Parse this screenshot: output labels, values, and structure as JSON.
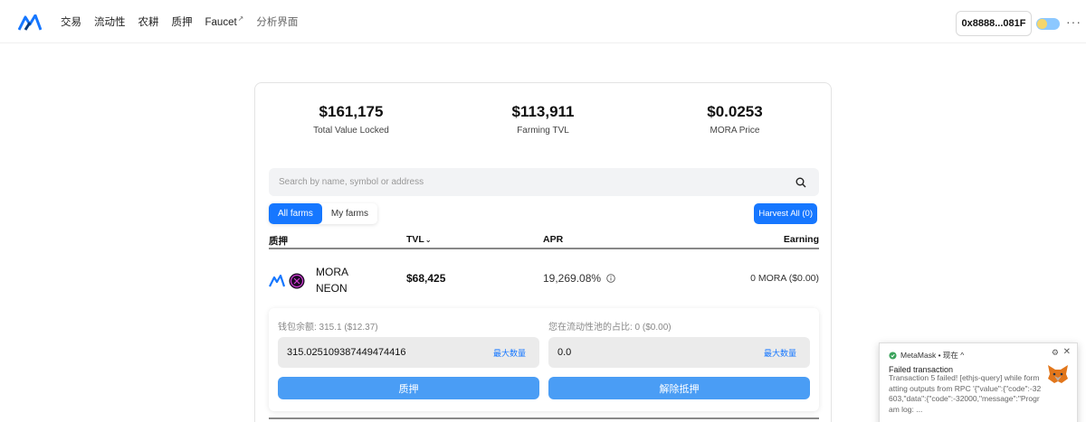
{
  "nav": {
    "items": [
      {
        "label": "交易"
      },
      {
        "label": "流动性"
      },
      {
        "label": "农耕"
      },
      {
        "label": "质押"
      },
      {
        "label": "Faucet"
      },
      {
        "label": "分析界面"
      }
    ],
    "wallet_address": "0x8888...081F",
    "more_glyph": "···"
  },
  "stats": [
    {
      "value": "$161,175",
      "label": "Total Value Locked"
    },
    {
      "value": "$113,911",
      "label": "Farming TVL"
    },
    {
      "value": "$0.0253",
      "label": "MORA Price"
    }
  ],
  "search": {
    "placeholder": "Search by name, symbol or address"
  },
  "tabs": {
    "all": "All farms",
    "mine": "My farms",
    "active": "all"
  },
  "harvest_label": "Harvest All (0)",
  "table": {
    "headers": {
      "pair": "质押",
      "tvl": "TVL",
      "apr": "APR",
      "earning": "Earning"
    },
    "rows": [
      {
        "token_a": "MORA",
        "token_b": "NEON",
        "tvl": "$68,425",
        "apr": "19,269.08%",
        "earning": "0 MORA ($0.00)"
      }
    ]
  },
  "detail": {
    "wallet_balance_label": "钱包余额: 315.1 ($12.37)",
    "wallet_amount": "315.025109387449474416",
    "pool_share_label": "您在流动性池的占比: 0 ($0.00)",
    "pool_amount": "0.0",
    "max_label": "最大数量",
    "stake_button": "质押",
    "unstake_button": "解除抵押"
  },
  "notification": {
    "app": "MetaMask",
    "time": "• 现在 ^",
    "title": "Failed transaction",
    "body": "Transaction 5 failed! [ethjs-query] while formatting outputs from RPC '{\"value\":{\"code\":-32603,\"data\":{\"code\":-32000,\"message\":\"Program log: ..."
  },
  "colors": {
    "accent": "#1677ff",
    "button_light": "#4a9df5"
  }
}
